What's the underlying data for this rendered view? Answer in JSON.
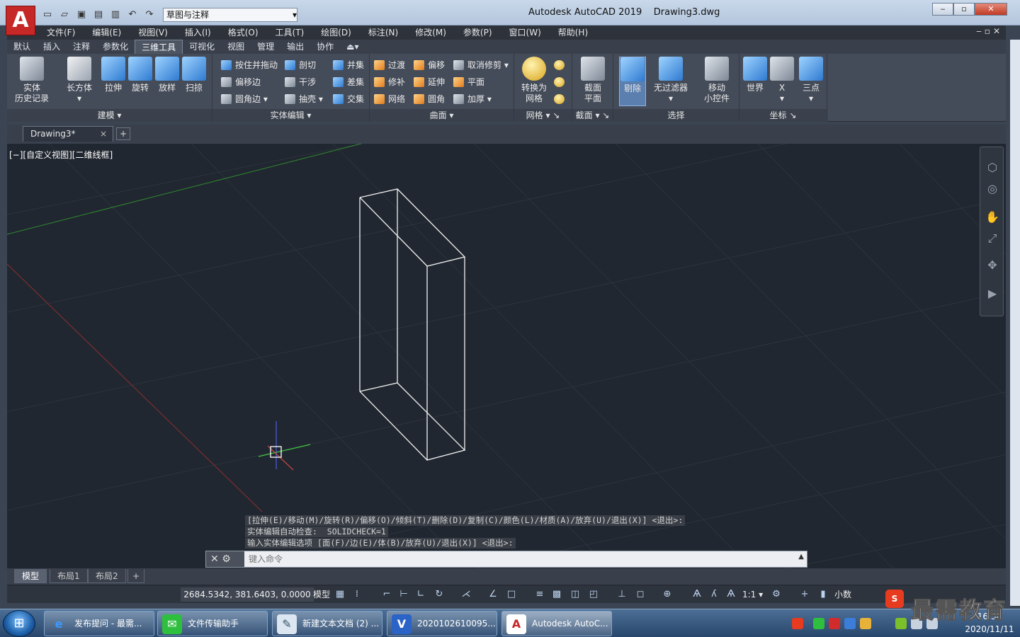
{
  "titlebar": {
    "workspace": "草图与注释",
    "title": "Autodesk AutoCAD 2019    Drawing3.dwg",
    "logo_letter": "A"
  },
  "menu": [
    "文件(F)",
    "编辑(E)",
    "视图(V)",
    "插入(I)",
    "格式(O)",
    "工具(T)",
    "绘图(D)",
    "标注(N)",
    "修改(M)",
    "参数(P)",
    "窗口(W)",
    "帮助(H)"
  ],
  "ribbon_tabs": [
    "默认",
    "插入",
    "注释",
    "参数化",
    "三维工具",
    "可视化",
    "视图",
    "管理",
    "输出",
    "协作"
  ],
  "ribbon": {
    "modeling": {
      "title": "建模",
      "solid_history_1": "实体",
      "solid_history_2": "历史记录",
      "box": "长方体",
      "extrude": "拉伸",
      "revolve": "旋转",
      "loft": "放样",
      "sweep": "扫掠"
    },
    "solid_edit": {
      "title": "实体编辑",
      "presspull": "按住并拖动",
      "offset_edge": "偏移边",
      "fillet_edge": "圆角边",
      "slice": "剖切",
      "interfere": "干涉",
      "shell": "抽壳",
      "union": "并集",
      "subtract": "差集",
      "intersect": "交集"
    },
    "surface": {
      "title": "曲面",
      "blend": "过渡",
      "offset": "偏移",
      "untrim": "取消修剪",
      "trim": "修补",
      "extend": "延伸",
      "planar": "平面",
      "network": "网络",
      "fillet": "圆角",
      "thicken": "加厚"
    },
    "mesh": {
      "title": "网格",
      "convert_1": "转换为",
      "convert_2": "网格"
    },
    "section": {
      "title": "截面",
      "plane_1": "截面",
      "plane_2": "平面"
    },
    "selection": {
      "title": "选择",
      "cull": "剔除",
      "no_filter": "无过滤器",
      "gizmo_1": "移动",
      "gizmo_2": "小控件"
    },
    "coordinates": {
      "title": "坐标",
      "world": "世界",
      "x": "X",
      "three_point": "三点"
    }
  },
  "file_tab": {
    "name": "Drawing3*",
    "close": "×",
    "new": "+"
  },
  "viewport": {
    "label": "[−][自定义视图][二维线框]"
  },
  "command_history": [
    "[拉伸(E)/移动(M)/旋转(R)/偏移(O)/倾斜(T)/删除(D)/复制(C)/颜色(L)/材质(A)/放弃(U)/退出(X)] <退出>:",
    "实体编辑自动检查:  SOLIDCHECK=1",
    "输入实体编辑选项 [面(F)/边(E)/体(B)/放弃(U)/退出(X)] <退出>:"
  ],
  "command_line": {
    "placeholder": "键入命令"
  },
  "layout_tabs": [
    "模型",
    "布局1",
    "布局2"
  ],
  "status": {
    "coords": "2684.5342, 381.6403, 0.0000",
    "model": "模型",
    "scale": "1:1",
    "units": "小数"
  },
  "taskbar": {
    "items": [
      "发布提问 - 最需...",
      "文件传输助手",
      "新建文本文档 (2) ...",
      "2020102610095...",
      "Autodesk AutoC..."
    ],
    "clock_time": "16:38",
    "clock_date": "2020/11/11"
  },
  "watermark": {
    "text": "最需教育"
  },
  "colors": {
    "viewport_bg": "#212730",
    "ribbon_bg": "#454c59",
    "accent": "#c62828"
  }
}
